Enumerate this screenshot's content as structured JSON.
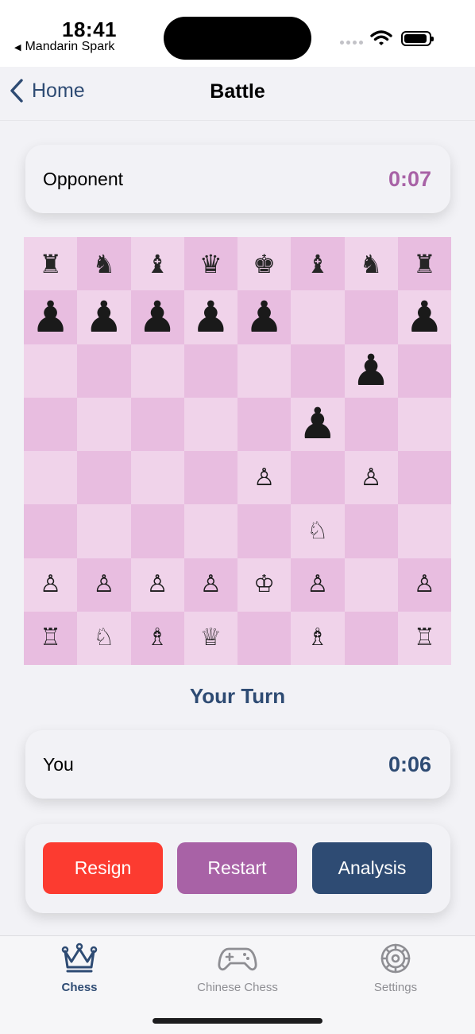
{
  "status_bar": {
    "time": "18:41",
    "back_app": "Mandarin Spark",
    "icons": [
      "signal-icon",
      "wifi-icon",
      "battery-icon"
    ]
  },
  "navbar": {
    "back_label": "Home",
    "title": "Battle"
  },
  "opponent": {
    "name": "Opponent",
    "timer": "0:07"
  },
  "you": {
    "name": "You",
    "timer": "0:06"
  },
  "turn_label": "Your Turn",
  "board": {
    "orientation": "white-bottom",
    "ranks": [
      [
        "bR",
        "bN",
        "bB",
        "bQ",
        "bK",
        "bB",
        "bN",
        "bR"
      ],
      [
        "bP",
        "bP",
        "bP",
        "bP",
        "bP",
        "",
        "",
        "bP"
      ],
      [
        "",
        "",
        "",
        "",
        "",
        "",
        "bP",
        ""
      ],
      [
        "",
        "",
        "",
        "",
        "",
        "bP",
        "",
        ""
      ],
      [
        "",
        "",
        "",
        "",
        "wP",
        "",
        "wP",
        ""
      ],
      [
        "",
        "",
        "",
        "",
        "",
        "wN",
        "",
        ""
      ],
      [
        "wP",
        "wP",
        "wP",
        "wP",
        "wK",
        "wP",
        "",
        "wP"
      ],
      [
        "wR",
        "wN",
        "wB",
        "wQ",
        "",
        "wB",
        "",
        "wR"
      ]
    ]
  },
  "actions": {
    "resign": "Resign",
    "restart": "Restart",
    "analysis": "Analysis"
  },
  "tabs": [
    {
      "label": "Chess",
      "icon": "crown-icon",
      "selected": true
    },
    {
      "label": "Chinese Chess",
      "icon": "gamecontroller-icon",
      "selected": false
    },
    {
      "label": "Settings",
      "icon": "gear-icon",
      "selected": false
    }
  ],
  "colors": {
    "accent": "#2e4b73",
    "opponent_timer": "#a862a6",
    "light_square": "#f0d3ea",
    "dark_square": "#e8bde0",
    "resign": "#fc3b30",
    "restart": "#a862a6",
    "analysis": "#2e4b73"
  }
}
